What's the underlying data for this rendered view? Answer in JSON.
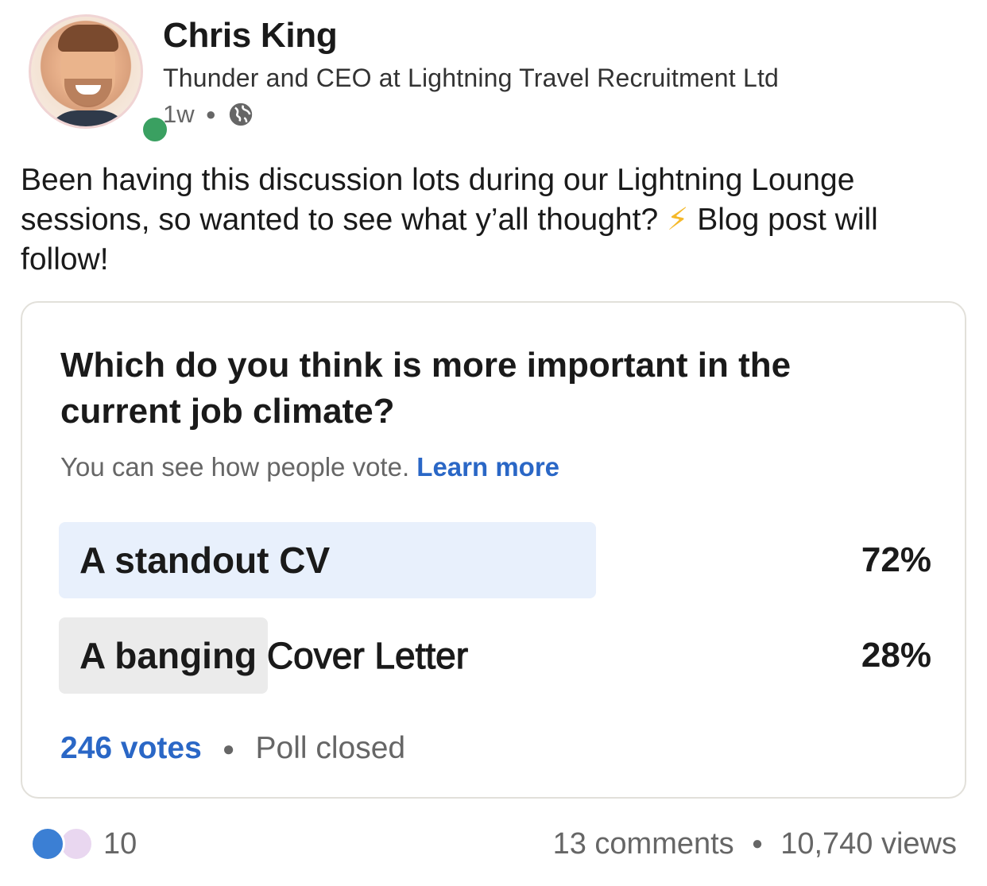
{
  "author": {
    "name": "Chris King",
    "headline": "Thunder and CEO at Lightning Travel Recruitment Ltd",
    "time": "1w",
    "visibility_icon": "globe-icon",
    "online": true
  },
  "post": {
    "text_part1": "Been having this discussion lots during our Lightning Lounge sessions, so wanted to see what y’all thought? ",
    "emoji": "⚡",
    "text_part2": " Blog post will follow!"
  },
  "poll": {
    "question": "Which do you think is more important in the current job climate?",
    "note": "You can see how people vote.",
    "learn_more": "Learn more",
    "options": [
      {
        "label": "A standout CV",
        "percent_text": "72%",
        "percent": 72
      },
      {
        "label_bold": "A banging",
        "label_rest": " Cover Letter",
        "percent_text": "28%",
        "percent": 28
      }
    ],
    "votes": "246 votes",
    "status": "Poll closed",
    "accent_color": "#2a67c6"
  },
  "social": {
    "reactions": [
      "like-icon",
      "funny-icon"
    ],
    "reaction_count": "10",
    "comments": "13 comments",
    "views": "10,740 views"
  }
}
